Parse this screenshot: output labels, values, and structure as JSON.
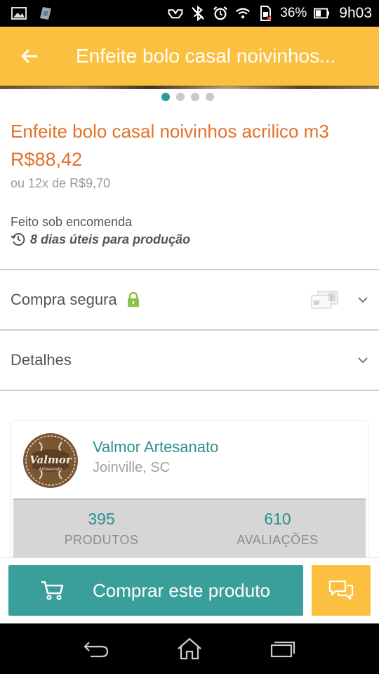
{
  "status_bar": {
    "battery_percent": "36%",
    "time": "9h03",
    "icons": [
      "image-icon",
      "app-icon",
      "nfc-icon",
      "bluetooth-off-icon",
      "alarm-icon",
      "wifi-icon",
      "sim-icon",
      "battery-icon"
    ]
  },
  "toolbar": {
    "title": "Enfeite bolo casal noivinhos...",
    "back_icon": "arrow-left-icon"
  },
  "gallery": {
    "total_images": 4,
    "active_index": 0
  },
  "product": {
    "title": "Enfeite bolo casal noivinhos acrilico m3",
    "price": "R$88,42",
    "installments": "ou 12x de R$9,70",
    "made_to_order": "Feito sob encomenda",
    "production_time": "8 dias úteis para produção"
  },
  "sections": {
    "secure_purchase": "Compra segura",
    "details": "Detalhes"
  },
  "seller": {
    "name": "Valmor Artesanato",
    "location": "Joinville, SC",
    "logo_text": "Valmor",
    "logo_subtext": "Artesanato",
    "stats": [
      {
        "value": "395",
        "label": "PRODUTOS"
      },
      {
        "value": "610",
        "label": "AVALIAÇÕES"
      }
    ]
  },
  "actions": {
    "buy_label": "Comprar este produto"
  },
  "colors": {
    "accent_yellow": "#fbc03f",
    "teal": "#3a9e9b",
    "orange_text": "#e2722a"
  }
}
